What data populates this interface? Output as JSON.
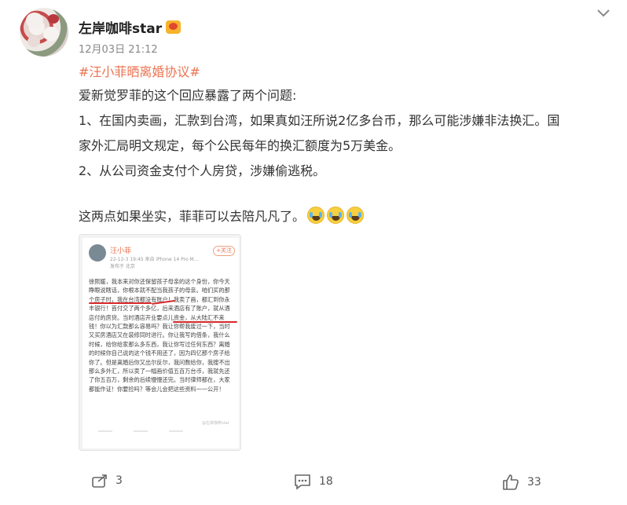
{
  "post": {
    "user_name": "左岸咖啡star",
    "time": "12月03日 21:12",
    "hashtag": "#汪小菲晒离婚协议#",
    "lines": [
      "爱新觉罗菲的这个回应暴露了两个问题:",
      "1、在国内卖画，汇款到台湾，如果真如汪所说2亿多台币，那么可能涉嫌非法换汇。国",
      "家外汇局明文规定，每个公民每年的换汇额度为5万美金。",
      "2、从公司资金支付个人房贷，涉嫌偷逃税。",
      "这两点如果坐实，菲菲可以去陪凡凡了。"
    ]
  },
  "embedded": {
    "name": "汪小菲",
    "meta": "22-12-3 19:45  来自 iPhone 14 Pro M...",
    "location": "发布于 北京",
    "follow": "+关注",
    "body": "徐熙媛，我本来对你还保留孩子母亲的这个身份，你今天睁眼说瞎话，你根本就不配当我孩子的母亲。咱们买的那个房子时，我在台湾都没有账户！我卖了画，都汇到你永丰银行！首付交了两个多亿，后来酒店有了账户，就从酒店付的房贷。当时酒店开业要点儿资金，从大陆汇不来钱！你以为汇款那么容易吗？我让你帮我废过一下，当时又买房酒店又在装修同时进行。你让我写的借条，我什么时候，给你给家那么多东西，我让你写过任何东西？离婚的时候你自己说的这个钱不用还了，因为四亿那个房子给你了。但是离婚后你又出尔反尔，我问数给你，我搜不出那么多外汇，所以卖了一幅画价值五百万台币，我就先还了你五百万，剩余的后续慢慢还完。当时律师都在，大家都能作证！你要捡吗？等会儿会把这些资料一一公开！",
    "watermark": "@左岸咖啡star"
  },
  "actions": {
    "share_count": "3",
    "comment_count": "18",
    "like_count": "33"
  },
  "icons": {
    "more": "chevron-down-icon",
    "share": "share-icon",
    "comment": "comment-icon",
    "like": "thumbs-up-icon"
  },
  "colors": {
    "hashtag": "#eb7350",
    "text": "#333333",
    "meta": "#888888"
  }
}
